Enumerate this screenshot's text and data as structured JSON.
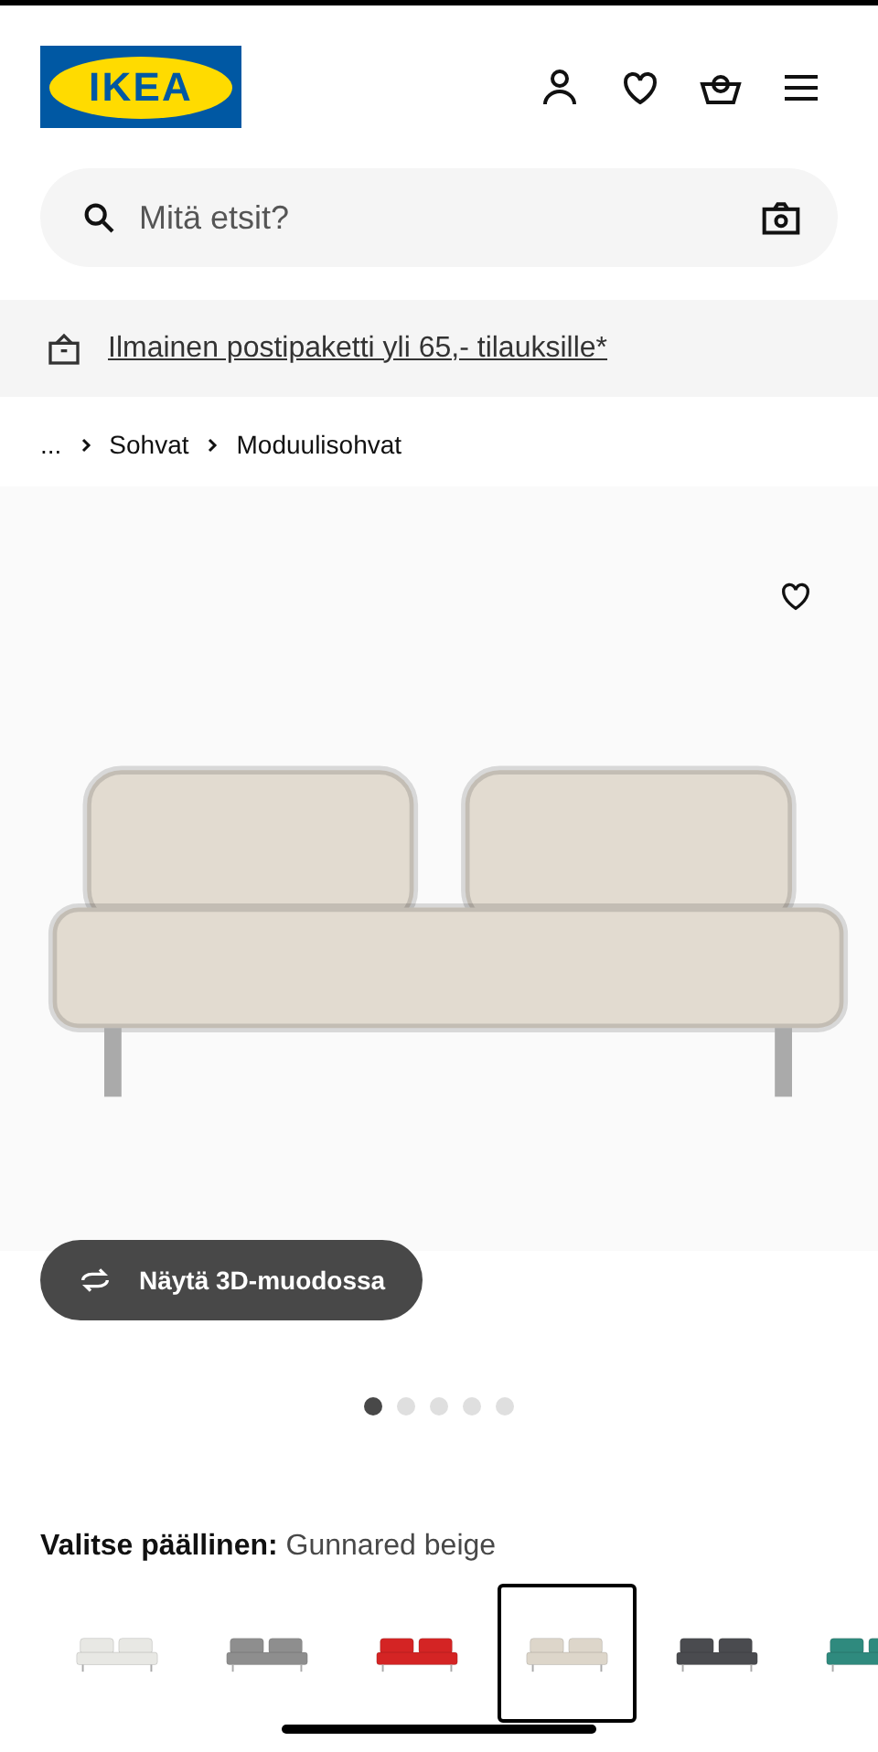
{
  "logo": {
    "text": "IKEA"
  },
  "search": {
    "placeholder": "Mitä etsit?"
  },
  "promo": {
    "text": "Ilmainen postipaketti yli 65,- tilauksille*"
  },
  "breadcrumb": [
    "...",
    "Sohvat",
    "Moduulisohvat"
  ],
  "gallery": {
    "view_3d_button": "Näytä 3D-muodossa",
    "dots": [
      {
        "selected": true
      },
      {
        "selected": false
      },
      {
        "selected": false
      },
      {
        "selected": false
      },
      {
        "selected": false
      }
    ]
  },
  "cover_picker": {
    "label": "Valitse päällinen:",
    "value": "Gunnared beige",
    "swatches": [
      {
        "color": "#e8e8e4",
        "selected": false
      },
      {
        "color": "#8e8e8e",
        "selected": false
      },
      {
        "color": "#d42424",
        "selected": false
      },
      {
        "color": "#ddd6ca",
        "selected": true
      },
      {
        "color": "#4a4b4f",
        "selected": false
      },
      {
        "color": "#2f8a7e",
        "selected": false
      }
    ]
  }
}
